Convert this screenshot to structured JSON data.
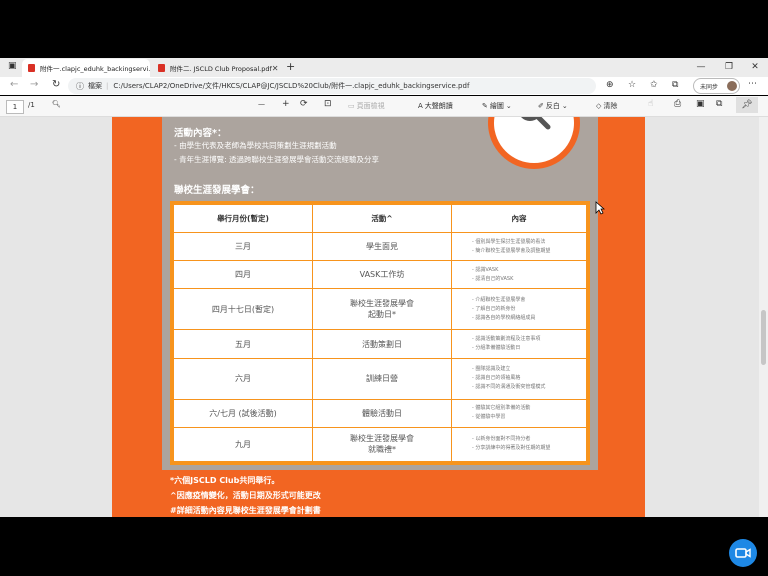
{
  "tabs": [
    {
      "label": "附件一.clapjc_eduhk_backingservi...",
      "active": true
    },
    {
      "label": "附件二. JSCLD Club Proposal.pdf",
      "active": false
    }
  ],
  "new_tab": "+",
  "window": {
    "minimize": "—",
    "restore": "❐",
    "close": "✕"
  },
  "address": {
    "scheme_label": "檔案",
    "url": "C:/Users/CLAP2/OneDrive/文件/HKCS/CLAP@JC/JSCLD%20Club/附件一.clapjc_eduhk_backingservice.pdf"
  },
  "profile_label": "未同步",
  "pdf_toolbar": {
    "page": "1",
    "page_total": "/1",
    "minus": "—",
    "plus": "+",
    "fit_page": "頁面檢視",
    "read_aloud": "大聲朗讀",
    "draw": "繪圖",
    "highlight": "反白",
    "erase": "清除"
  },
  "doc": {
    "section1_title": "活動內容*：",
    "bullet1": "- 由學生代表及老師為學校共同策劃生涯規劃活動",
    "bullet2": "- 青年生涯博覽: 透過跨聯校生涯發展學會活動交流經驗及分享",
    "section2_title": "聯校生涯發展學會：",
    "headers": [
      "舉行月份(暫定)",
      "活動^",
      "內容"
    ],
    "rows": [
      {
        "month": "三月",
        "activity": "學生面見",
        "content": [
          "- 個別與學生探討生涯發展的看法",
          "- 簡介聯校生涯發展學會及調整期望"
        ]
      },
      {
        "month": "四月",
        "activity": "VASK工作坊",
        "content": [
          "- 認識VASK",
          "- 認清自己的VASK"
        ]
      },
      {
        "month": "四月十七日(暫定)",
        "activity": "聯校生涯發展學會\n起動日*",
        "content": [
          "- 介紹聯校生涯發展學會",
          "- 了解自己的新身份",
          "- 認識各自的學校網絡組成員"
        ]
      },
      {
        "month": "五月",
        "activity": "活動策劃日",
        "content": [
          "- 認識活動策劃流程及注意事項",
          "- 分組準備體驗活動日"
        ]
      },
      {
        "month": "六月",
        "activity": "訓練日營",
        "content": [
          "- 團隊認識及建立",
          "- 認識自己的領袖風格",
          "- 認識不同的溝通及衝突管理模式"
        ]
      },
      {
        "month": "六/七月 (試後活動)",
        "activity": "體驗活動日",
        "content": [
          "- 體驗其它組別準備的活動",
          "- 從體驗中學習"
        ]
      },
      {
        "month": "九月",
        "activity": "聯校生涯發展學會\n就職禮*",
        "content": [
          "- 以新身份面對不同持分者",
          "- 分享訓練中的得著及對任期的期望"
        ]
      }
    ],
    "note1": "*六個JSCLD Club共同舉行。",
    "note2": "^因應疫情變化，活動日期及形式可能更改",
    "note3": "#詳細活動內容見聯校生涯發展學會計劃書"
  },
  "colors": {
    "orange": "#f26522",
    "gray_box": "#aca49e",
    "table_border": "#f7941d"
  }
}
